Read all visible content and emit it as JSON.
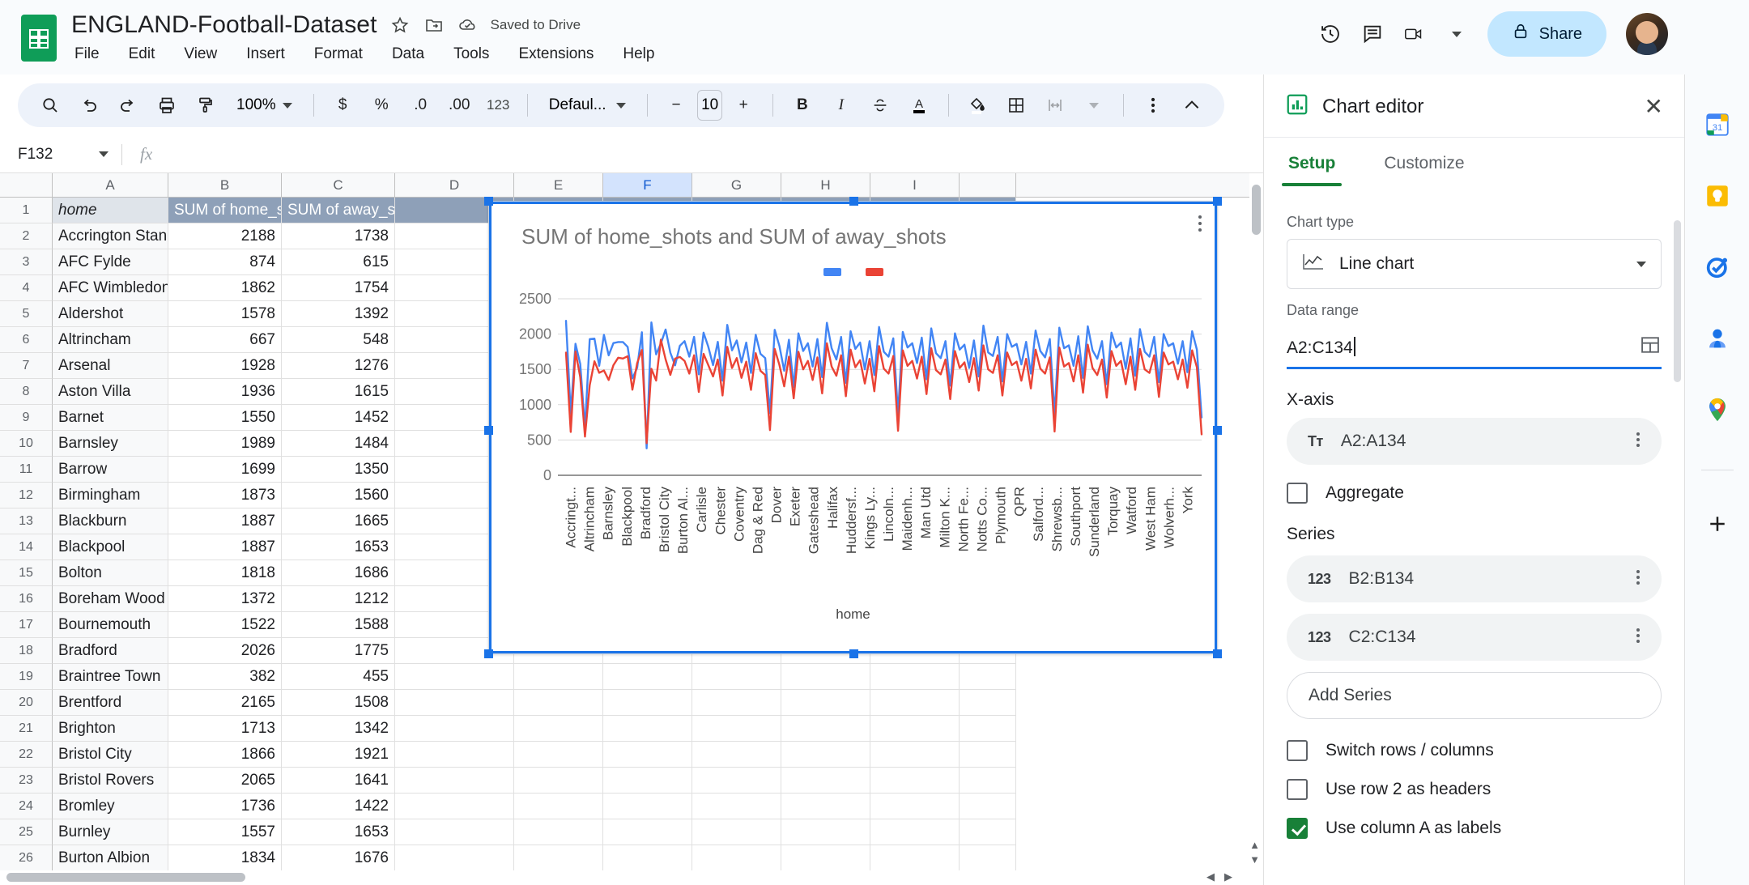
{
  "app": {
    "doc_title": "ENGLAND-Football-Dataset",
    "save_status": "Saved to Drive",
    "menus": [
      "File",
      "Edit",
      "View",
      "Insert",
      "Format",
      "Data",
      "Tools",
      "Extensions",
      "Help"
    ],
    "share_label": "Share"
  },
  "toolbar": {
    "zoom": "100%",
    "currency": "$",
    "percent": "%",
    "dec_less": ".0",
    "dec_more": ".00",
    "more_formats": "123",
    "font": "Defaul...",
    "minus": "−",
    "font_size": "10",
    "plus": "+",
    "bold": "B",
    "italic": "I",
    "strikethrough": "S"
  },
  "formula_bar": {
    "name_box": "F132",
    "fx": "fx",
    "formula_value": ""
  },
  "sheet": {
    "columns": [
      "A",
      "B",
      "C",
      "D",
      "E",
      "F",
      "G",
      "H",
      "I"
    ],
    "selected_column": "F",
    "header_row": [
      "home",
      "SUM of home_shots",
      "SUM of away_shots"
    ],
    "rows": [
      {
        "n": "2",
        "a": "Accrington Stanl",
        "b": "2188",
        "c": "1738"
      },
      {
        "n": "3",
        "a": "AFC Fylde",
        "b": "874",
        "c": "615"
      },
      {
        "n": "4",
        "a": "AFC Wimbledon",
        "b": "1862",
        "c": "1754"
      },
      {
        "n": "5",
        "a": "Aldershot",
        "b": "1578",
        "c": "1392"
      },
      {
        "n": "6",
        "a": "Altrincham",
        "b": "667",
        "c": "548"
      },
      {
        "n": "7",
        "a": "Arsenal",
        "b": "1928",
        "c": "1276"
      },
      {
        "n": "8",
        "a": "Aston Villa",
        "b": "1936",
        "c": "1615"
      },
      {
        "n": "9",
        "a": "Barnet",
        "b": "1550",
        "c": "1452"
      },
      {
        "n": "10",
        "a": "Barnsley",
        "b": "1989",
        "c": "1484"
      },
      {
        "n": "11",
        "a": "Barrow",
        "b": "1699",
        "c": "1350"
      },
      {
        "n": "12",
        "a": "Birmingham",
        "b": "1873",
        "c": "1560"
      },
      {
        "n": "13",
        "a": "Blackburn",
        "b": "1887",
        "c": "1665"
      },
      {
        "n": "14",
        "a": "Blackpool",
        "b": "1887",
        "c": "1653"
      },
      {
        "n": "15",
        "a": "Bolton",
        "b": "1818",
        "c": "1686"
      },
      {
        "n": "16",
        "a": "Boreham Wood",
        "b": "1372",
        "c": "1212"
      },
      {
        "n": "17",
        "a": "Bournemouth",
        "b": "1522",
        "c": "1588"
      },
      {
        "n": "18",
        "a": "Bradford",
        "b": "2026",
        "c": "1775"
      },
      {
        "n": "19",
        "a": "Braintree Town",
        "b": "382",
        "c": "455"
      },
      {
        "n": "20",
        "a": "Brentford",
        "b": "2165",
        "c": "1508"
      },
      {
        "n": "21",
        "a": "Brighton",
        "b": "1713",
        "c": "1342"
      },
      {
        "n": "22",
        "a": "Bristol City",
        "b": "1866",
        "c": "1921"
      },
      {
        "n": "23",
        "a": "Bristol Rovers",
        "b": "2065",
        "c": "1641"
      },
      {
        "n": "24",
        "a": "Bromley",
        "b": "1736",
        "c": "1422"
      },
      {
        "n": "25",
        "a": "Burnley",
        "b": "1557",
        "c": "1653"
      },
      {
        "n": "26",
        "a": "Burton Albion",
        "b": "1834",
        "c": "1676"
      }
    ]
  },
  "chart_data": {
    "type": "line",
    "title": "SUM of home_shots and SUM of away_shots",
    "xlabel": "home",
    "ylabel": "",
    "ylim": [
      0,
      2500
    ],
    "yticks": [
      0,
      500,
      1000,
      1500,
      2000,
      2500
    ],
    "grid": true,
    "legend_position": "top",
    "colors": {
      "home_shots": "#4285f4",
      "away_shots": "#ea4335"
    },
    "tick_labels": [
      "Accringt...",
      "Altrincham",
      "Barnsley",
      "Blackpool",
      "Bradford",
      "Bristol City",
      "Burton Al...",
      "Carlisle",
      "Chester",
      "Coventry",
      "Dag & Red",
      "Dover",
      "Exeter",
      "Gateshead",
      "Halifax",
      "Huddersf...",
      "Kings Ly...",
      "Lincoln...",
      "Maidenh...",
      "Man Utd",
      "Milton K...",
      "North Fe...",
      "Notts Co...",
      "Plymouth",
      "QPR",
      "Salford...",
      "Shrewsb...",
      "Southport",
      "Sunderland",
      "Torquay",
      "Watford",
      "West Ham",
      "Wolverh...",
      "York"
    ],
    "series": [
      {
        "name": "SUM of home_shots",
        "color": "#4285f4",
        "values": [
          2188,
          874,
          1862,
          1578,
          667,
          1928,
          1936,
          1550,
          1989,
          1699,
          1873,
          1887,
          1887,
          1818,
          1372,
          1522,
          2026,
          382,
          2165,
          1713,
          1866,
          2065,
          1736,
          1557,
          1834,
          1900,
          1680,
          1960,
          1430,
          2020,
          1820,
          1560,
          1890,
          1340,
          2130,
          1770,
          1910,
          1600,
          1880,
          1450,
          1990,
          1720,
          1660,
          880,
          2060,
          1830,
          1480,
          1920,
          1250,
          2010,
          1760,
          1870,
          1540,
          1930,
          1390,
          2160,
          1800,
          1640,
          1960,
          1310,
          2040,
          1790,
          1880,
          1500,
          1900,
          1420,
          2100,
          1750,
          1680,
          1940,
          870,
          2030,
          1810,
          1870,
          1590,
          1950,
          1360,
          2080,
          1730,
          1660,
          1900,
          1270,
          2010,
          1780,
          1850,
          1520,
          1910,
          1400,
          2120,
          1740,
          1690,
          1960,
          1330,
          2000,
          1820,
          1860,
          1570,
          1890,
          1440,
          2050,
          1760,
          1670,
          1930,
          860,
          2090,
          1800,
          1840,
          1550,
          1970,
          1380,
          2110,
          1770,
          1650,
          1900,
          1290,
          2020,
          1810,
          1880,
          1510,
          1940,
          1410,
          2070,
          1750,
          1680,
          1960,
          1320,
          2000,
          1830,
          1870,
          1580,
          1900,
          1460,
          2040,
          1780,
          820
        ]
      },
      {
        "name": "SUM of away_shots",
        "color": "#ea4335",
        "values": [
          1738,
          615,
          1754,
          1392,
          548,
          1276,
          1615,
          1452,
          1484,
          1350,
          1560,
          1665,
          1653,
          1686,
          1212,
          1588,
          1775,
          455,
          1508,
          1342,
          1921,
          1641,
          1422,
          1653,
          1676,
          1620,
          1440,
          1700,
          1180,
          1720,
          1560,
          1400,
          1640,
          1130,
          1820,
          1520,
          1660,
          1380,
          1610,
          1210,
          1730,
          1480,
          1420,
          640,
          1790,
          1560,
          1260,
          1680,
          1090,
          1750,
          1500,
          1620,
          1350,
          1670,
          1160,
          1870,
          1540,
          1410,
          1700,
          1120,
          1780,
          1530,
          1630,
          1300,
          1650,
          1190,
          1830,
          1510,
          1440,
          1690,
          630,
          1770,
          1550,
          1620,
          1370,
          1680,
          1150,
          1800,
          1490,
          1430,
          1640,
          1080,
          1760,
          1520,
          1600,
          1320,
          1660,
          1200,
          1840,
          1500,
          1450,
          1700,
          1130,
          1740,
          1560,
          1610,
          1340,
          1650,
          1230,
          1780,
          1510,
          1440,
          1670,
          620,
          1810,
          1540,
          1590,
          1330,
          1700,
          1170,
          1850,
          1520,
          1420,
          1640,
          1100,
          1760,
          1550,
          1620,
          1290,
          1680,
          1210,
          1790,
          1500,
          1450,
          1700,
          1110,
          1740,
          1570,
          1610,
          1360,
          1640,
          1240,
          1770,
          1530,
          580
        ]
      }
    ]
  },
  "editor": {
    "title": "Chart editor",
    "tabs": [
      {
        "label": "Setup",
        "active": true
      },
      {
        "label": "Customize",
        "active": false
      }
    ],
    "chart_type_label": "Chart type",
    "chart_type_value": "Line chart",
    "data_range_label": "Data range",
    "data_range_value": "A2:C134",
    "x_axis_label": "X-axis",
    "x_axis_value": "A2:A134",
    "x_axis_type_icon": "Tт",
    "aggregate_label": "Aggregate",
    "aggregate_checked": false,
    "series_label": "Series",
    "series": [
      {
        "type_icon": "123",
        "value": "B2:B134"
      },
      {
        "type_icon": "123",
        "value": "C2:C134"
      }
    ],
    "add_series_label": "Add Series",
    "options": [
      {
        "label": "Switch rows / columns",
        "checked": false
      },
      {
        "label": "Use row 2 as headers",
        "checked": false
      },
      {
        "label": "Use column A as labels",
        "checked": true
      }
    ]
  },
  "rail": {
    "items": [
      "calendar-icon",
      "keep-icon",
      "tasks-icon",
      "contacts-icon",
      "maps-icon"
    ],
    "add_label": "+"
  }
}
